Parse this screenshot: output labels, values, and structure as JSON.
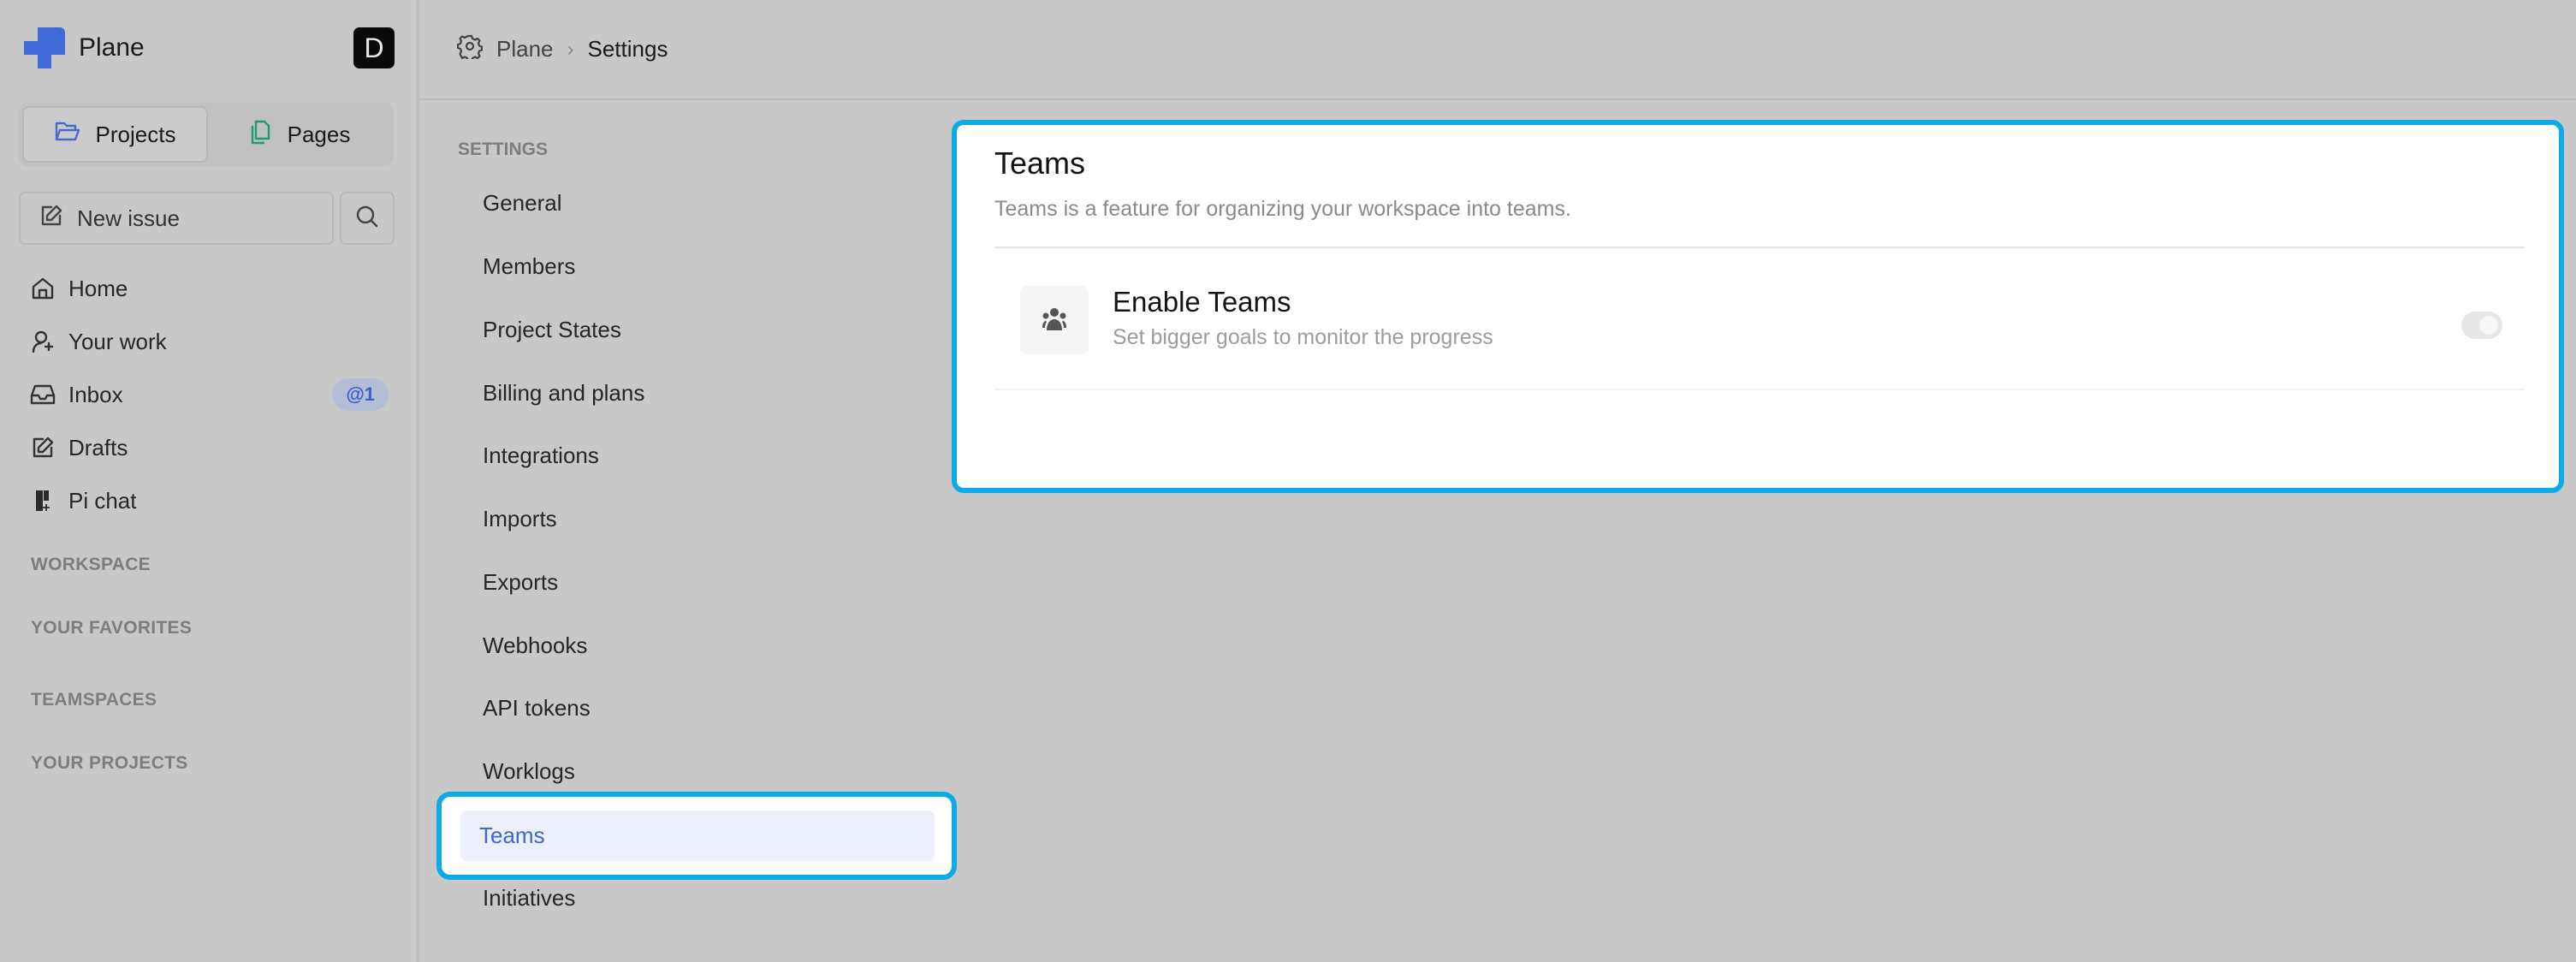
{
  "app": {
    "name": "Plane",
    "user_initial": "D"
  },
  "sidebar": {
    "segments": [
      {
        "label": "Projects",
        "icon": "folder-open-icon",
        "active": true
      },
      {
        "label": "Pages",
        "icon": "pages-icon",
        "active": false
      }
    ],
    "new_issue_label": "New issue",
    "nav": [
      {
        "label": "Home",
        "icon": "home-icon"
      },
      {
        "label": "Your work",
        "icon": "user-sparkle-icon"
      },
      {
        "label": "Inbox",
        "icon": "inbox-icon",
        "badge": "@1"
      },
      {
        "label": "Drafts",
        "icon": "pencil-square-icon"
      },
      {
        "label": "Pi chat",
        "icon": "pi-chat-icon"
      }
    ],
    "sections": [
      "WORKSPACE",
      "YOUR FAVORITES",
      "TEAMSPACES",
      "YOUR PROJECTS"
    ]
  },
  "header": {
    "breadcrumb": [
      "Plane",
      "Settings"
    ]
  },
  "settings_nav": {
    "label": "SETTINGS",
    "items": [
      "General",
      "Members",
      "Project States",
      "Billing and plans",
      "Integrations",
      "Imports",
      "Exports",
      "Webhooks",
      "API tokens",
      "Worklogs",
      "Teams",
      "Initiatives"
    ],
    "active": "Teams"
  },
  "content": {
    "title": "Teams",
    "description": "Teams is a feature for organizing your workspace into teams.",
    "feature": {
      "title": "Enable Teams",
      "description": "Set bigger goals to monitor the progress",
      "enabled": false
    }
  },
  "colors": {
    "accent": "#3f65d6",
    "highlight_border": "#0eaae5",
    "active_bg": "#ebf0fc"
  }
}
